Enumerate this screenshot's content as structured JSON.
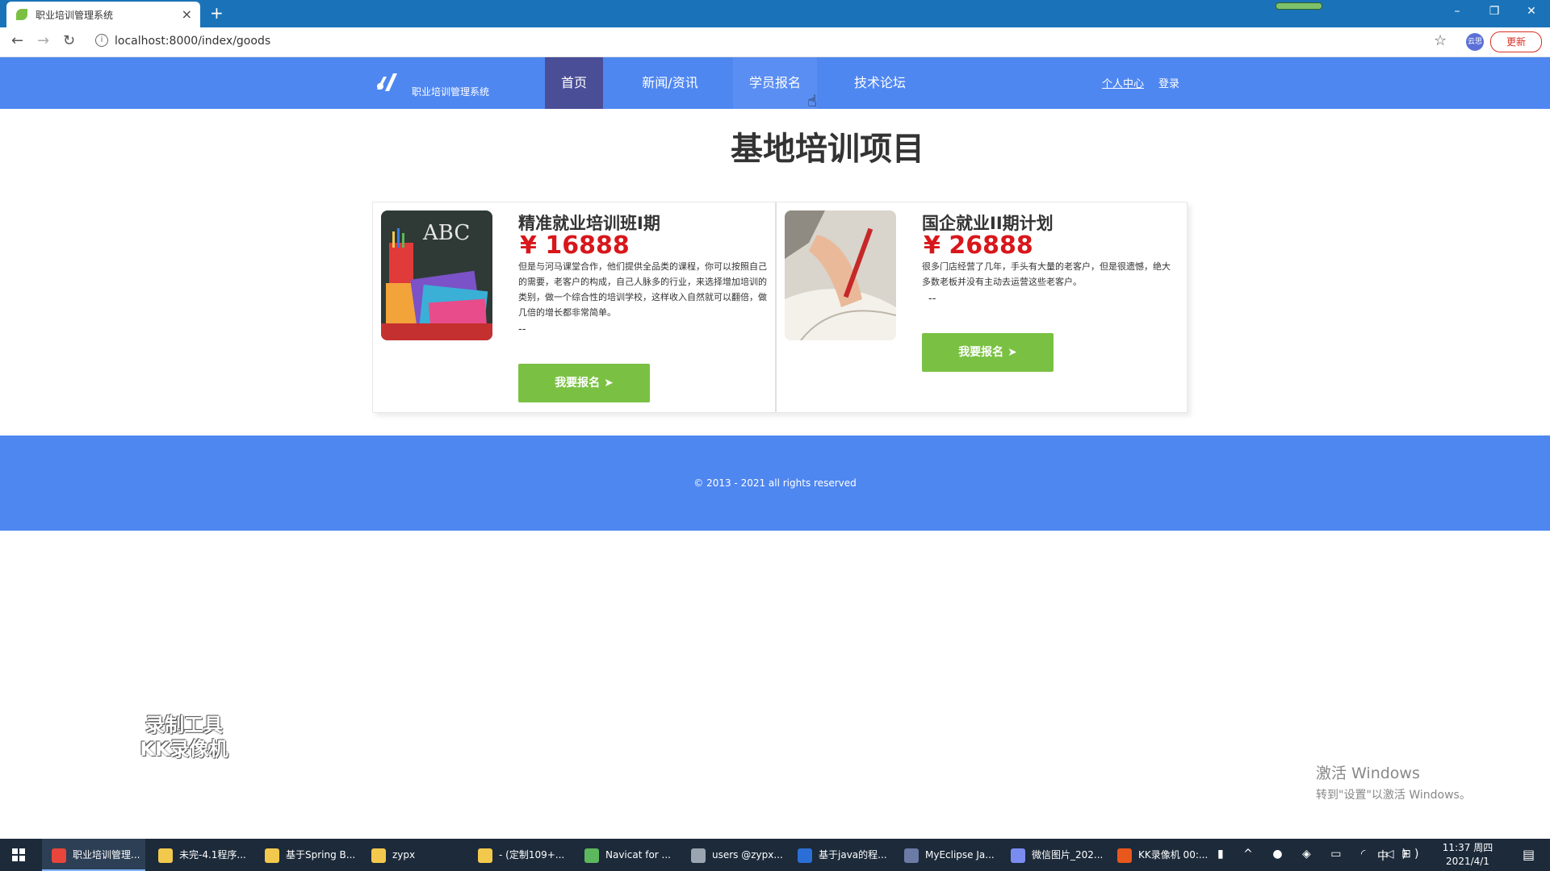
{
  "browser": {
    "tab_title": "职业培训管理系统",
    "tab_close": "×",
    "new_tab": "+",
    "url": "localhost:8000/index/goods",
    "update_label": "更新",
    "profile_label": "云思",
    "window_controls": [
      "–",
      "❐",
      "✕"
    ]
  },
  "header": {
    "logo_text": "职业培训管理系统",
    "nav": [
      "首页",
      "新闻/资讯",
      "学员报名",
      "技术论坛"
    ],
    "active_index": 0,
    "personal_center": "个人中心",
    "login": "登录"
  },
  "main": {
    "title": "基地培训项目",
    "items": [
      {
        "title": "精准就业培训班I期",
        "price": "¥ 16888",
        "description": "但是与河马课堂合作，他们提供全品类的课程，你可以按照自己的需要，老客户的构成，自己人脉多的行业，来选择增加培训的类别，做一个综合性的培训学校，这样收入自然就可以翻倍，做几倍的增长都非常简单。",
        "dash": "--",
        "button": "我要报名"
      },
      {
        "title": "国企就业II期计划",
        "price": "¥ 26888",
        "description": "很多门店经营了几年，手头有大量的老客户，但是很遗憾，绝大多数老板并没有主动去运营这些老客户。",
        "dash": "--",
        "button": "我要报名"
      }
    ]
  },
  "footer": {
    "copyright": "© 2013 - 2021 all rights reserved"
  },
  "overlay": {
    "watermark_line1": "录制工具",
    "watermark_line2": "KK录像机",
    "activate_line1": "激活 Windows",
    "activate_line2": "转到\"设置\"以激活 Windows。"
  },
  "taskbar": {
    "items": [
      {
        "label": "职业培训管理...",
        "icon_color": "#e8453c"
      },
      {
        "label": "未完-4.1程序...",
        "icon_color": "#f2c94c"
      },
      {
        "label": "基于Spring B...",
        "icon_color": "#f2c94c"
      },
      {
        "label": "zypx",
        "icon_color": "#f2c94c"
      },
      {
        "label": "- (定制109+...",
        "icon_color": "#f2c94c"
      },
      {
        "label": "Navicat for ...",
        "icon_color": "#5cb85c"
      },
      {
        "label": "users @zypx...",
        "icon_color": "#9aa5b1"
      },
      {
        "label": "基于java的程...",
        "icon_color": "#2b6fd6"
      },
      {
        "label": "MyEclipse Ja...",
        "icon_color": "#6c7aa6"
      },
      {
        "label": "微信图片_202...",
        "icon_color": "#7b8cf0"
      },
      {
        "label": "KK录像机 00:...",
        "icon_color": "#e8571c"
      }
    ],
    "ime": "中",
    "time": "11:37 周四",
    "date": "2021/4/1"
  },
  "colors": {
    "header_blue": "#4f87f1",
    "active_nav": "#4a4e96",
    "price_red": "#d8171b",
    "button_green": "#7ac143"
  }
}
